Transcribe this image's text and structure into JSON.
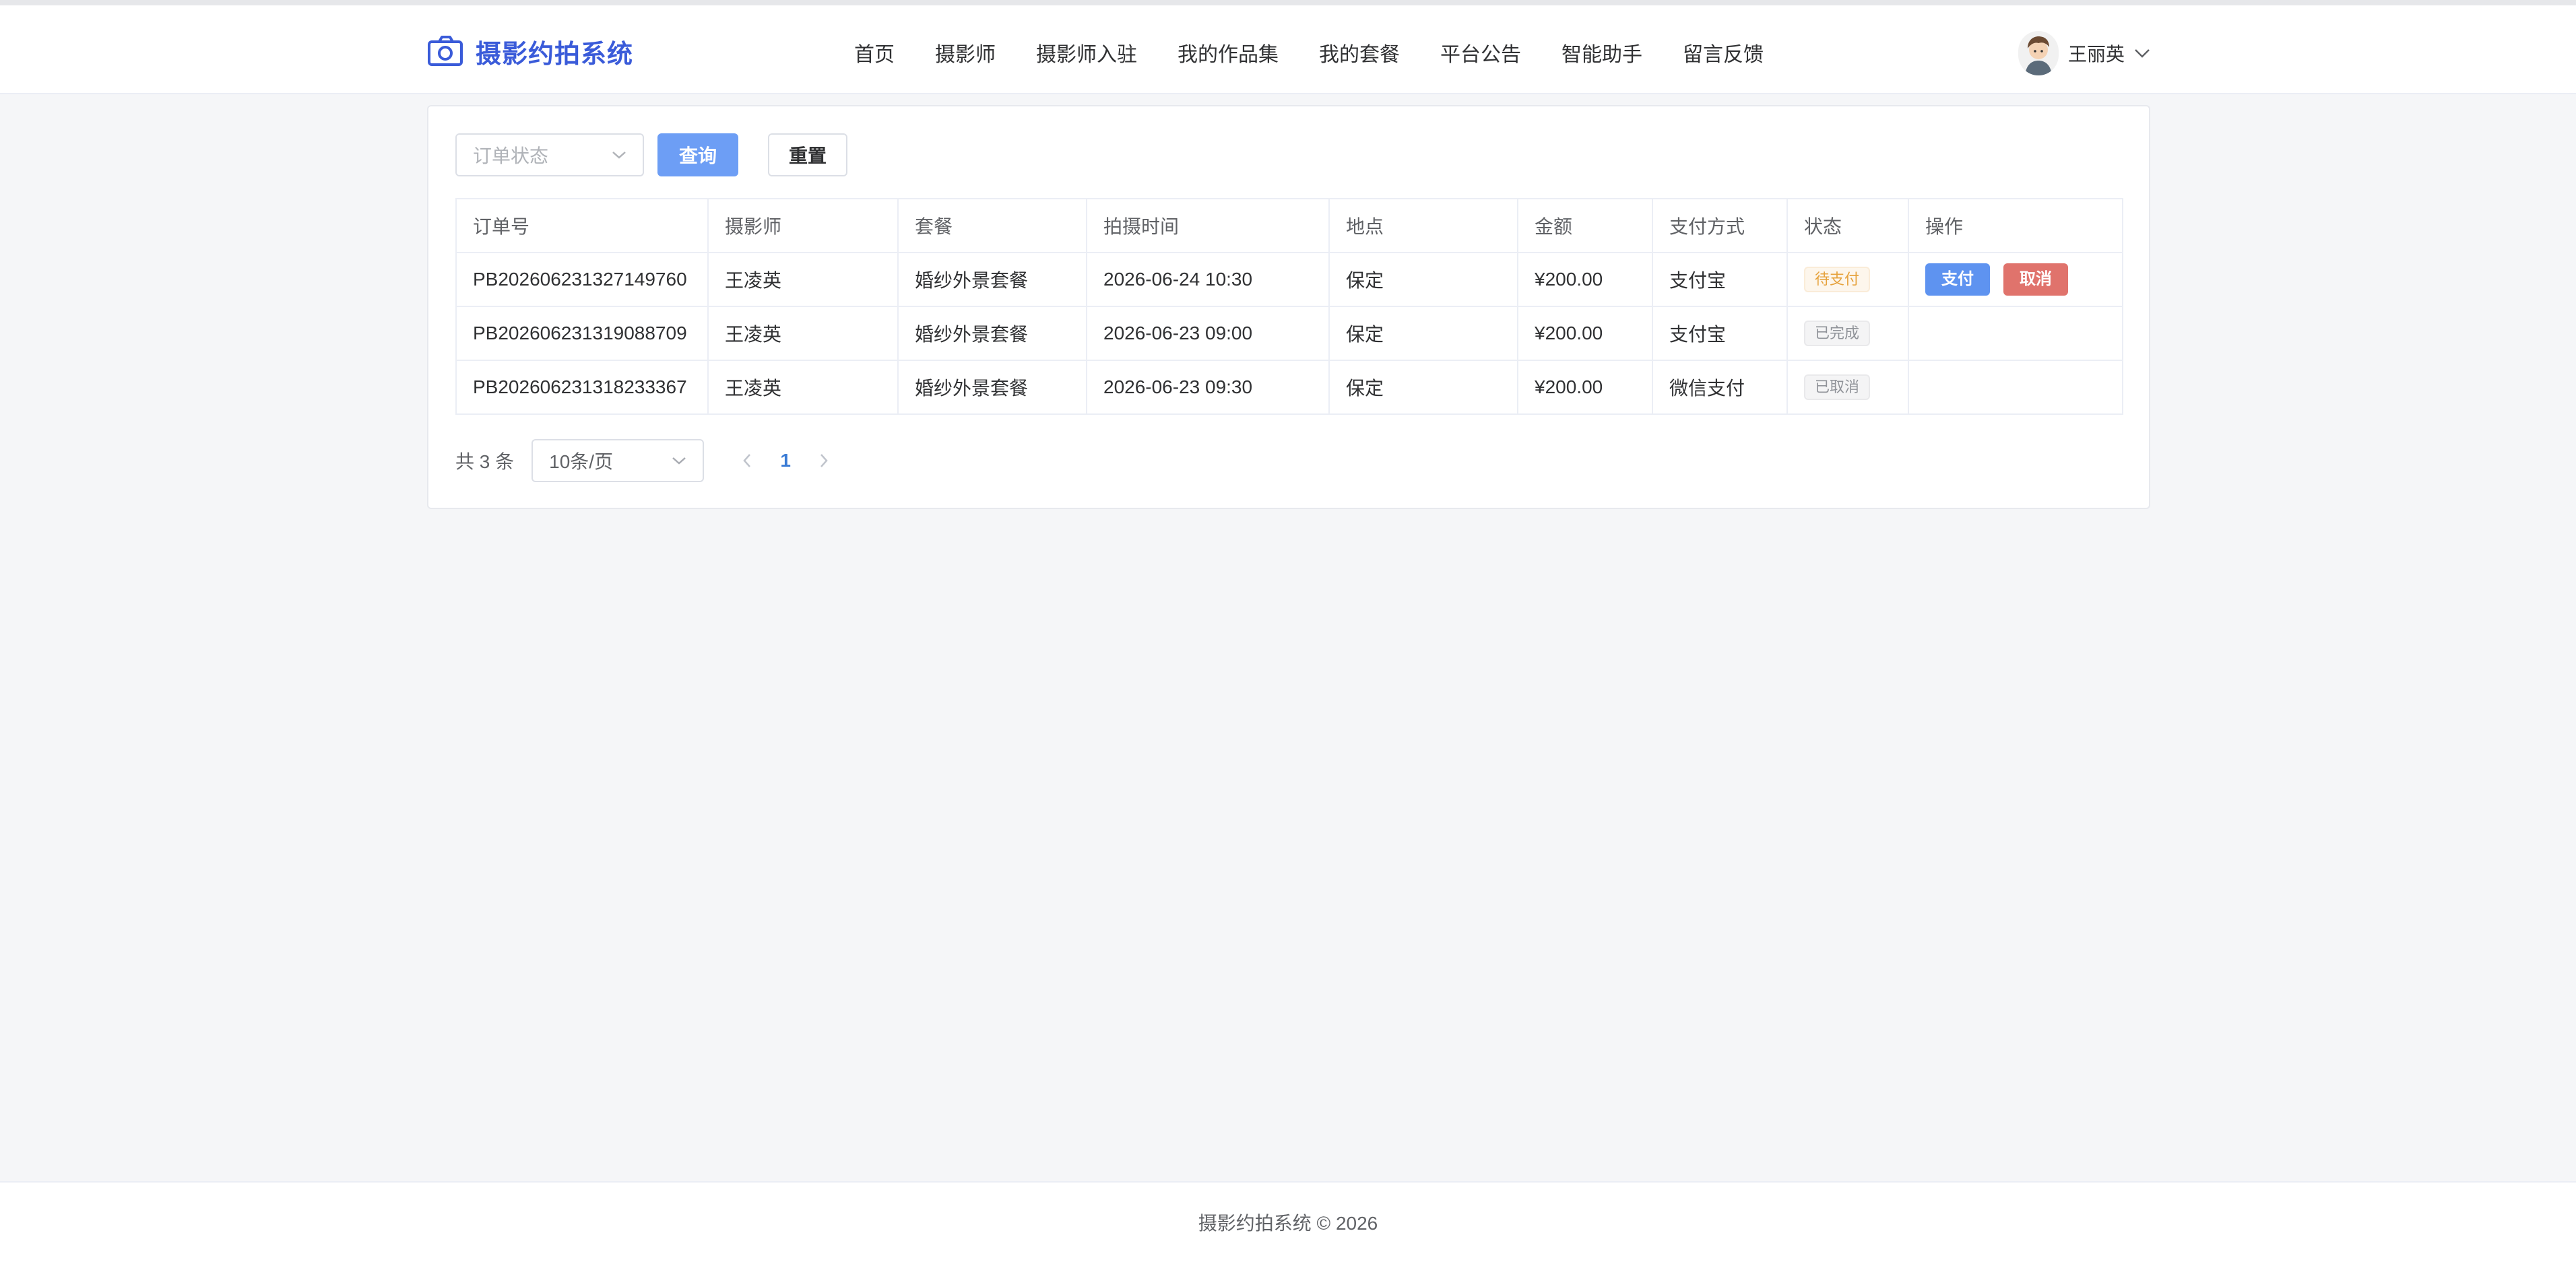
{
  "header": {
    "brand": "摄影约拍系统",
    "nav": [
      "首页",
      "摄影师",
      "摄影师入驻",
      "我的作品集",
      "我的套餐",
      "平台公告",
      "智能助手",
      "留言反馈"
    ],
    "user_name": "王丽英"
  },
  "filter": {
    "status_placeholder": "订单状态",
    "query_label": "查询",
    "reset_label": "重置"
  },
  "table": {
    "columns": [
      "订单号",
      "摄影师",
      "套餐",
      "拍摄时间",
      "地点",
      "金额",
      "支付方式",
      "状态",
      "操作"
    ],
    "rows": [
      {
        "order_no": "PB202606231327149760",
        "photographer": "王凌英",
        "package": "婚纱外景套餐",
        "time": "2026-06-24 10:30",
        "place": "保定",
        "amount": "¥200.00",
        "pay_method": "支付宝",
        "status": "待支付",
        "actions": [
          "支付",
          "取消"
        ]
      },
      {
        "order_no": "PB202606231319088709",
        "photographer": "王凌英",
        "package": "婚纱外景套餐",
        "time": "2026-06-23 09:00",
        "place": "保定",
        "amount": "¥200.00",
        "pay_method": "支付宝",
        "status": "已完成",
        "actions": []
      },
      {
        "order_no": "PB202606231318233367",
        "photographer": "王凌英",
        "package": "婚纱外景套餐",
        "time": "2026-06-23 09:30",
        "place": "保定",
        "amount": "¥200.00",
        "pay_method": "微信支付",
        "status": "已取消",
        "actions": []
      }
    ]
  },
  "pagination": {
    "total": "共 3 条",
    "page_size": "10条/页",
    "current_page": "1"
  },
  "footer": {
    "text": "摄影约拍系统 © 2026"
  },
  "colors": {
    "brand": "#3a5bd9",
    "primary": "#6d9ef5",
    "danger": "#e0736c",
    "warning": "#e6a23c"
  },
  "icons": {
    "logo": "camera-icon",
    "user_caret": "chevron-down-icon",
    "select_caret": "chevron-down-icon",
    "prev": "chevron-left-icon",
    "next": "chevron-right-icon"
  }
}
